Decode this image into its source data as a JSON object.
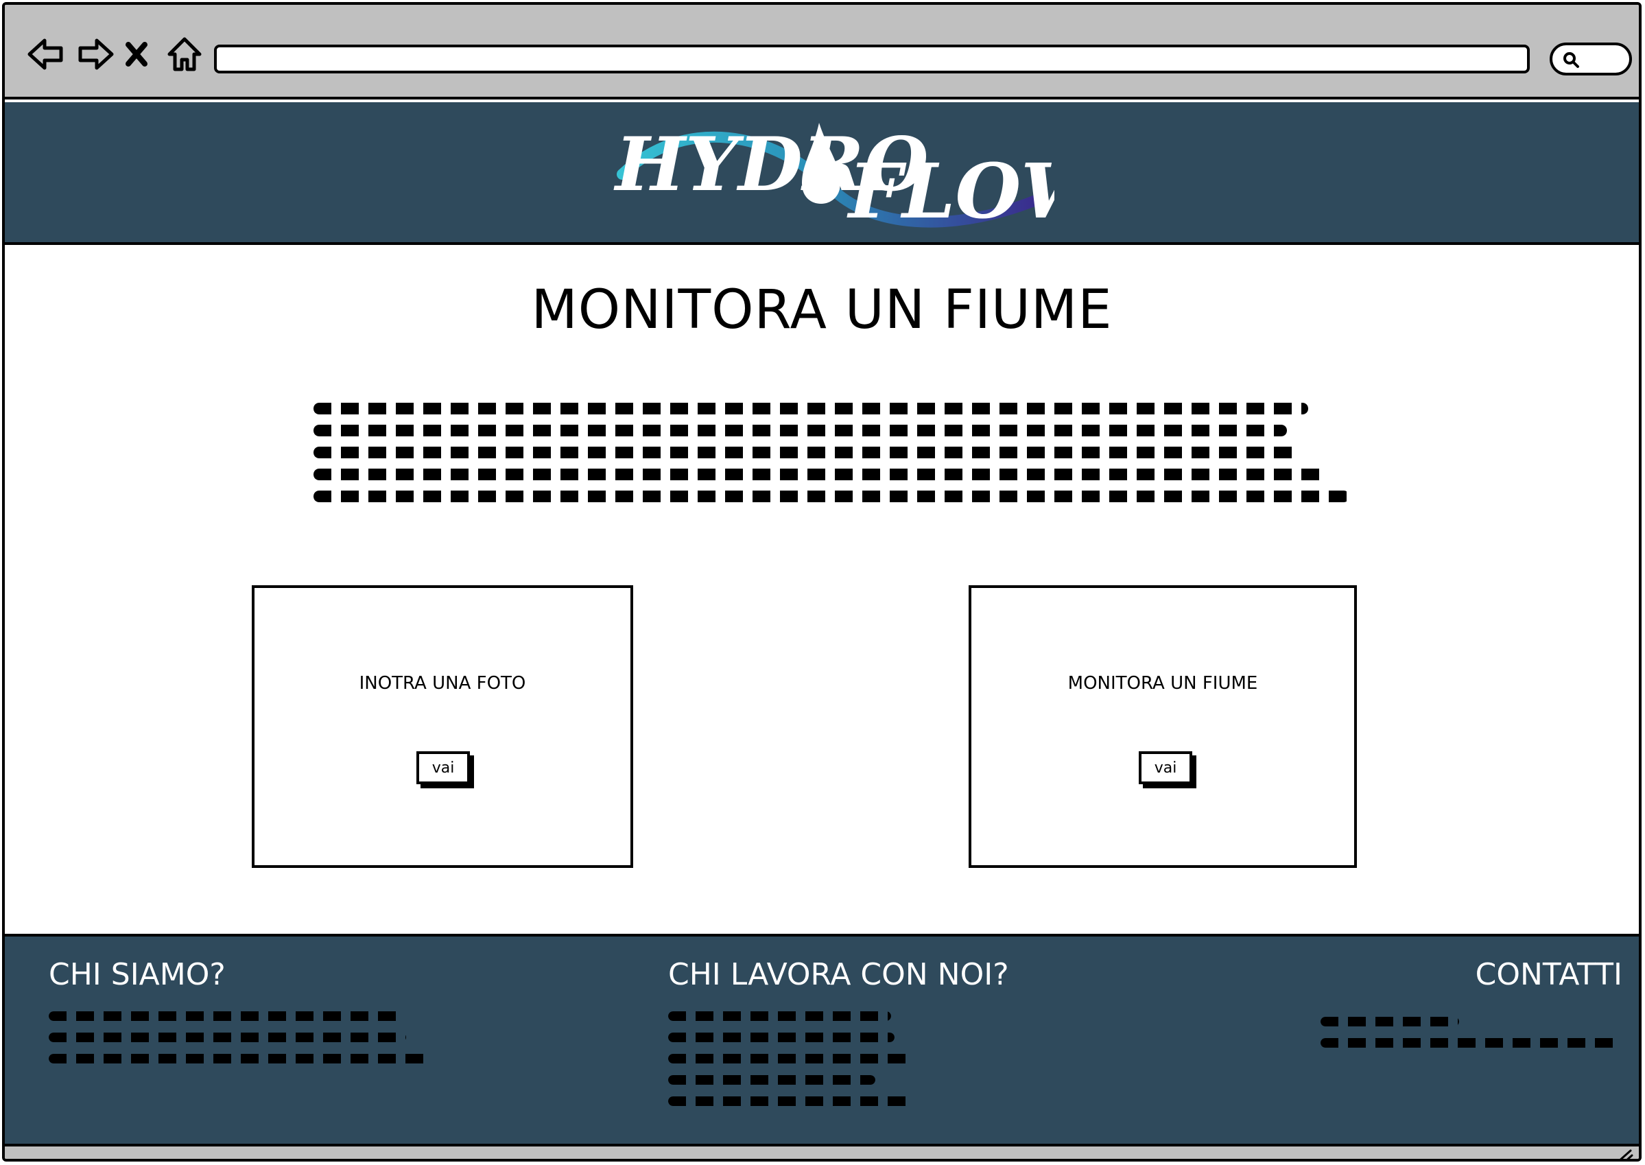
{
  "browser": {
    "icons": [
      "back-arrow-icon",
      "forward-arrow-icon",
      "close-icon",
      "home-icon",
      "search-icon"
    ],
    "address": ""
  },
  "header": {
    "logo_text": "HYDRO FLOW",
    "colors": {
      "background": "#2f4a5c",
      "wave_start": "#36c2d4",
      "wave_end": "#3a2a8c"
    }
  },
  "main": {
    "title": "MONITORA UN FIUME",
    "cards": [
      {
        "title": "INOTRA UNA FOTO",
        "button_label": "vai"
      },
      {
        "title": "MONITORA UN FIUME",
        "button_label": "vai"
      }
    ]
  },
  "footer": {
    "columns": [
      {
        "heading": "CHI SIAMO?"
      },
      {
        "heading": "CHI LAVORA CON NOI?"
      },
      {
        "heading": "CONTATTI"
      }
    ]
  }
}
